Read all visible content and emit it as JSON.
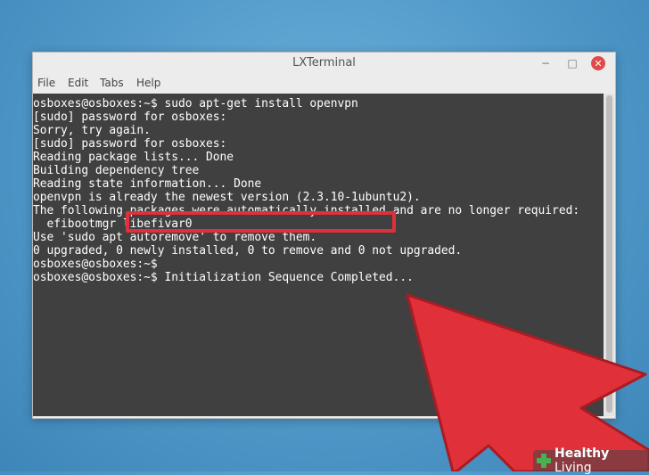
{
  "window": {
    "title": "LXTerminal",
    "controls": {
      "minimize": "−",
      "maximize": "□",
      "close": "✕"
    }
  },
  "menu": [
    "File",
    "Edit",
    "Tabs",
    "Help"
  ],
  "terminal": {
    "lines": [
      "osboxes@osboxes:~$ sudo apt-get install openvpn",
      "[sudo] password for osboxes:",
      "Sorry, try again.",
      "[sudo] password for osboxes:",
      "Reading package lists... Done",
      "Building dependency tree",
      "Reading state information... Done",
      "openvpn is already the newest version (2.3.10-1ubuntu2).",
      "The following packages were automatically installed and are no longer required:",
      "  efibootmgr libefivar0",
      "Use 'sudo apt autoremove' to remove them.",
      "0 upgraded, 0 newly installed, 0 to remove and 0 not upgraded.",
      "osboxes@osboxes:~$",
      "osboxes@osboxes:~$ Initialization Sequence Completed..."
    ]
  },
  "colors": {
    "terminal_bg": "#404040",
    "terminal_text": "#ffffff",
    "highlight": "#e0303a",
    "arrow": "#e0303a",
    "desktop": "#4f98c8"
  },
  "watermark": {
    "brand_bold": "Healthy",
    "brand_light": " Living"
  }
}
